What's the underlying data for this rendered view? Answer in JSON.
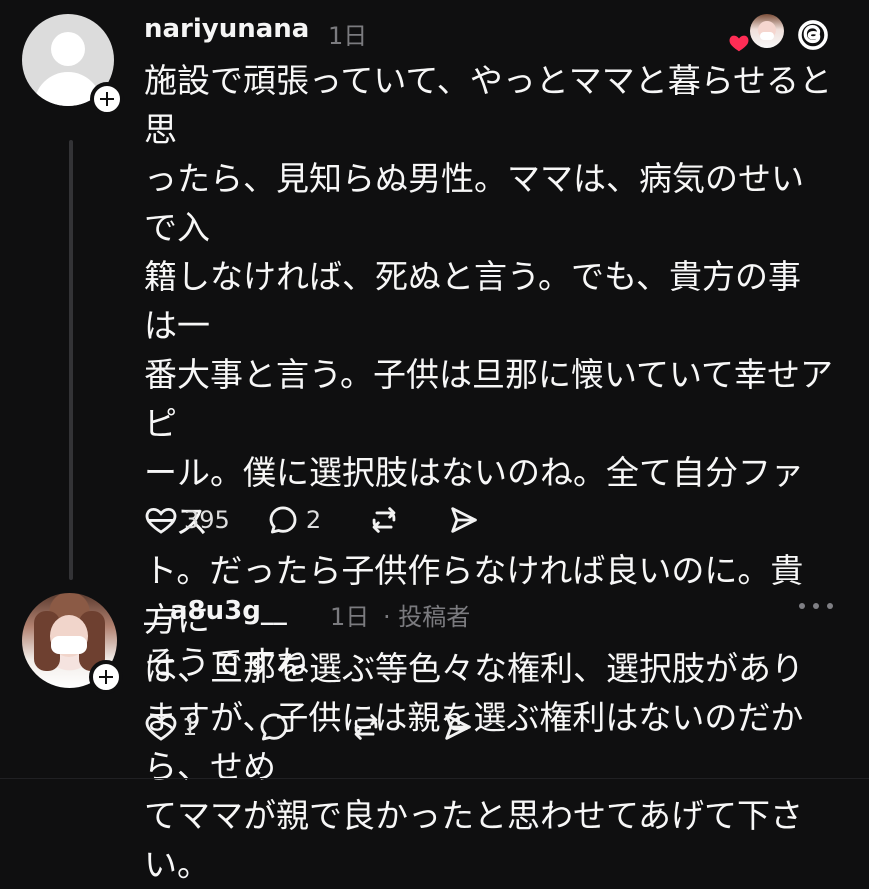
{
  "main_post": {
    "username": "nariyunana",
    "time": "1日",
    "text": "施設で頑張っていて、やっとママと暮らせると思\nったら、見知らぬ男性。ママは、病気のせいで入\n籍しなければ、死ぬと言う。でも、貴方の事は一\n番大事と言う。子供は旦那に懐いていて幸せアピ\nール。僕に選択肢はないのね。全て自分ファース\nト。だったら子供作らなければ良いのに。貴方に\nは、旦那を選ぶ等色々な権利、選択肢がありますが、子供には親を選ぶ権利はないのだから、せめ\nてママが親で良かったと思わせてあげて下さい。",
    "likes": "395",
    "replies": "2"
  },
  "reply_post": {
    "username": "__a8u3g__",
    "time": "1日",
    "author_label": "· 投稿者",
    "text": "そうですね",
    "likes": "1"
  },
  "icons": {
    "avatar_default": "default-avatar",
    "follow": "plus-icon",
    "heart_badge": "heart-icon",
    "threads": "threads-icon",
    "like": "heart-outline-icon",
    "reply": "comment-icon",
    "repost": "repost-icon",
    "share": "send-icon",
    "more": "more-icon"
  },
  "colors": {
    "background": "#0f0f10",
    "text": "#f3f3f3",
    "meta": "#7b7b7f",
    "accent_heart": "#ff2d55"
  }
}
